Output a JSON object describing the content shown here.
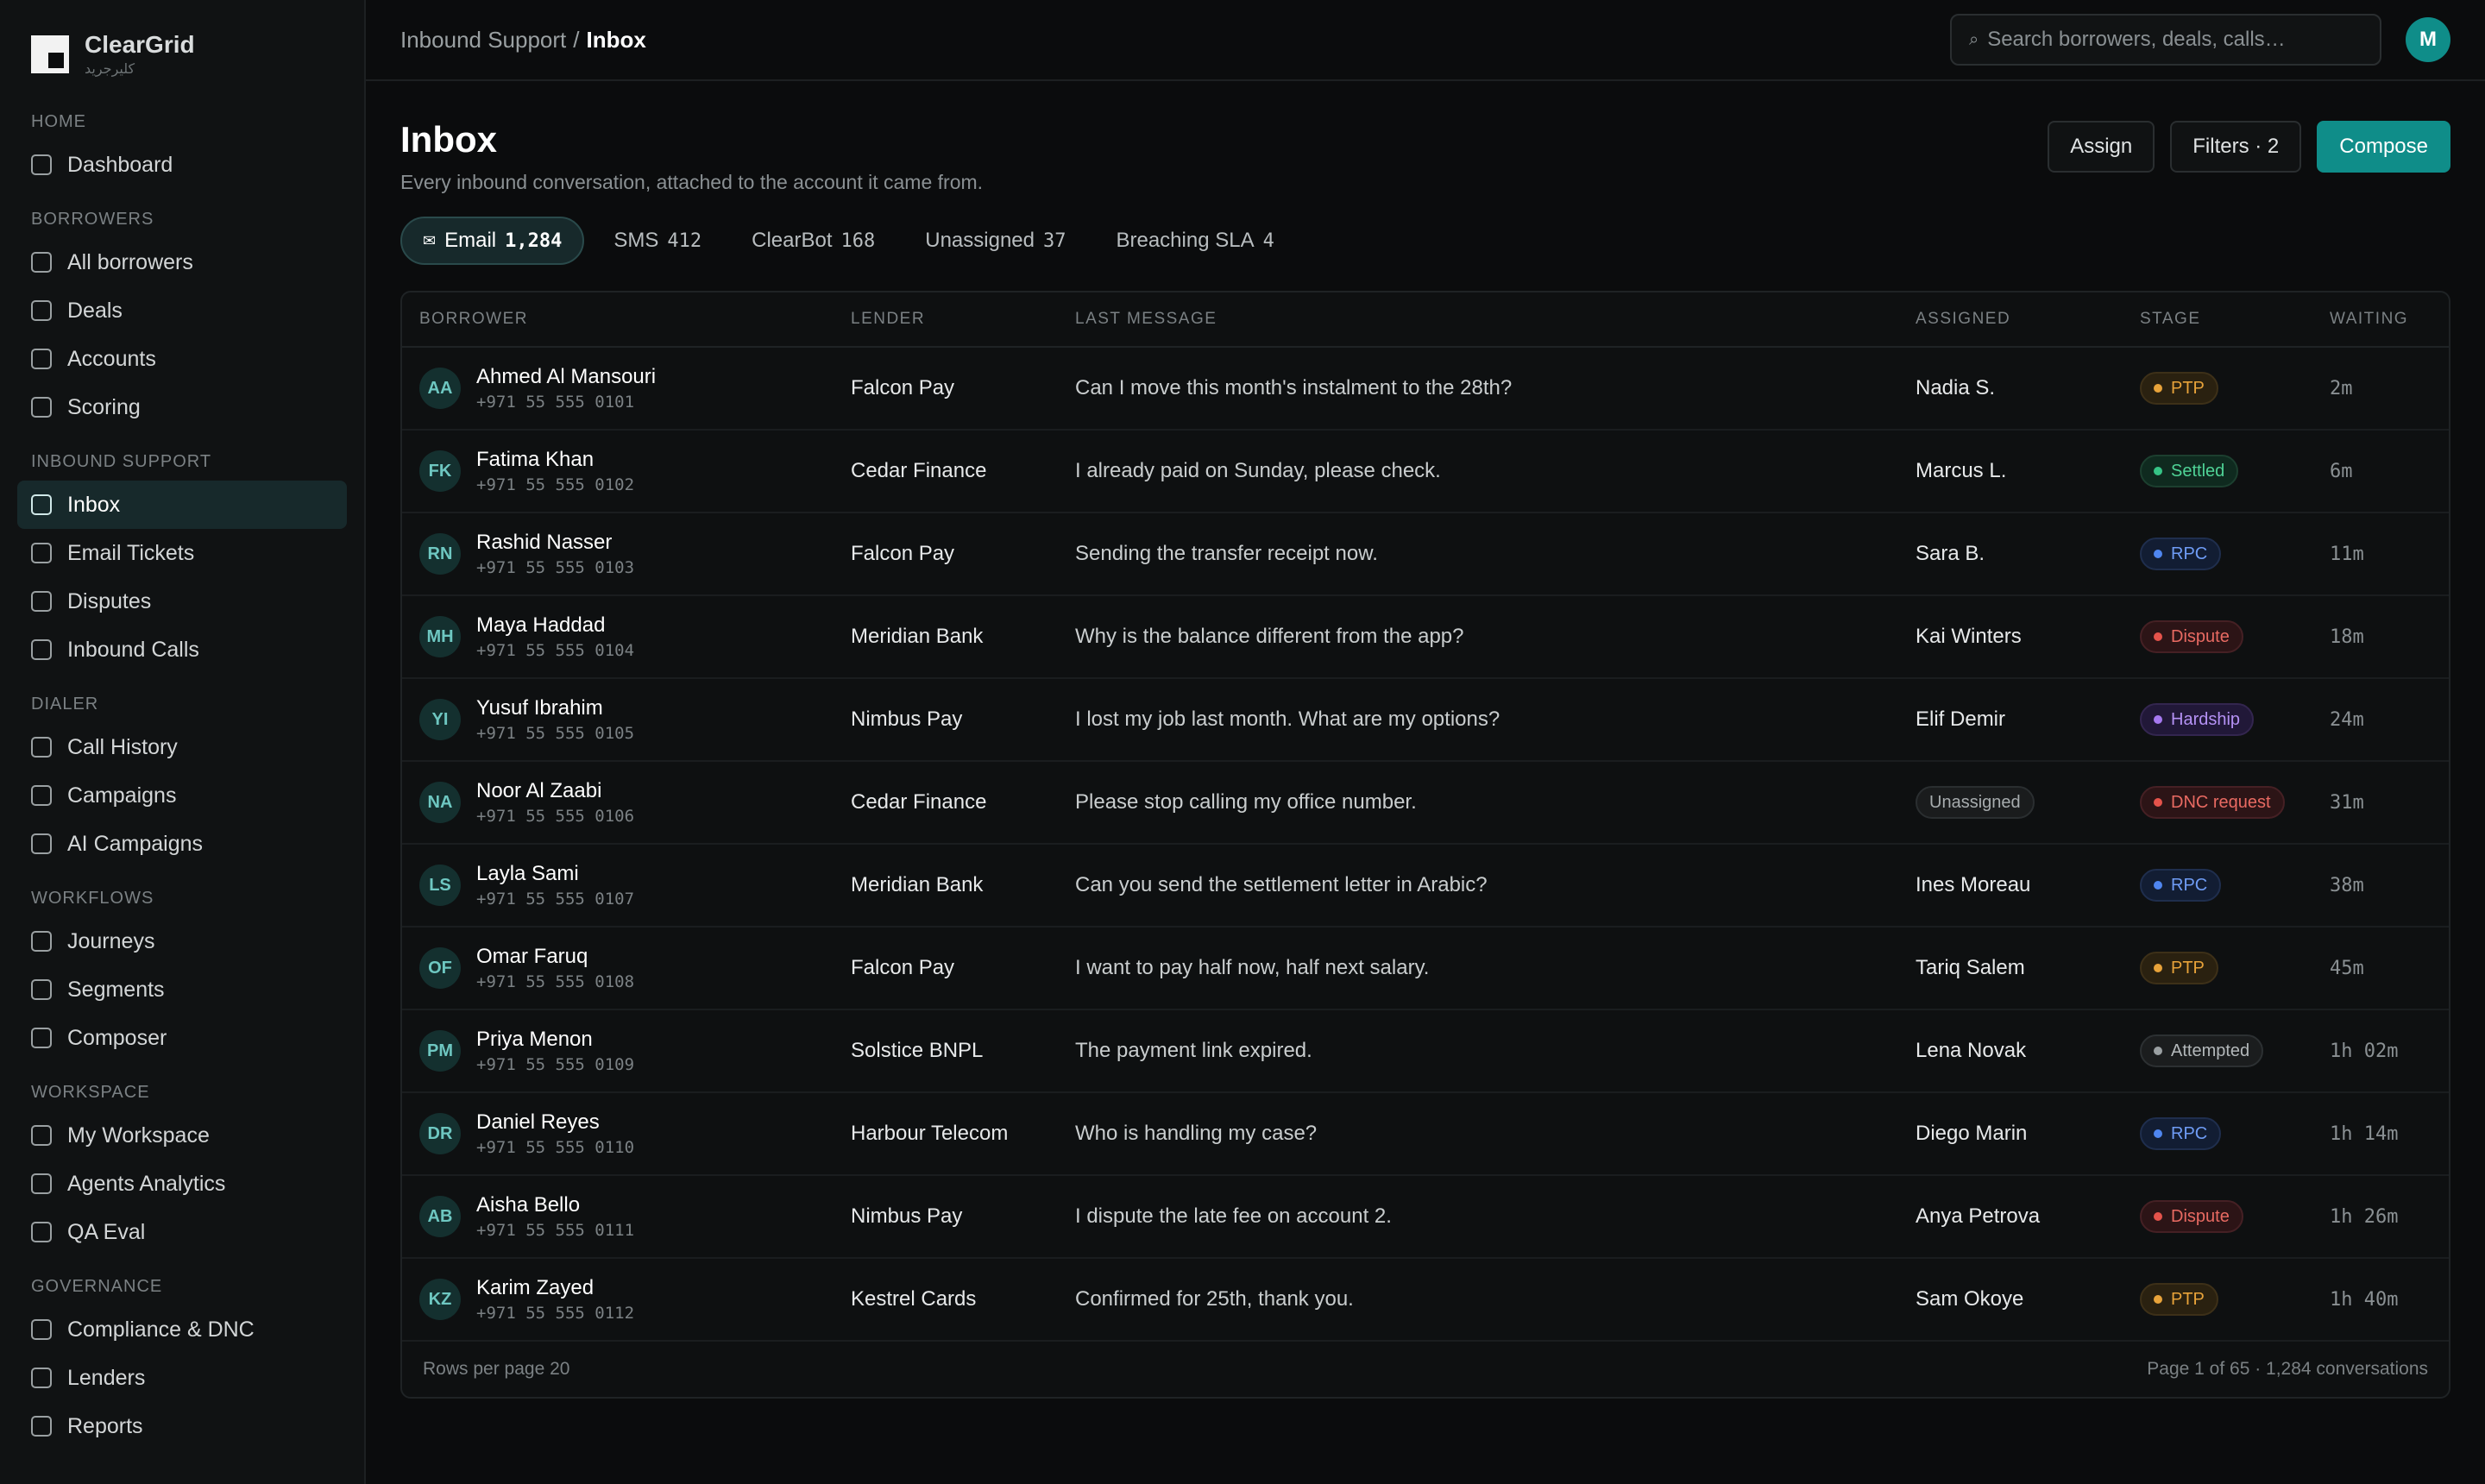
{
  "brand": {
    "name": "ClearGrid",
    "subtitle": "كليرجريد"
  },
  "sidebar": {
    "sections": [
      {
        "title": "HOME",
        "items": [
          "Dashboard"
        ]
      },
      {
        "title": "BORROWERS",
        "items": [
          "All borrowers",
          "Deals",
          "Accounts",
          "Scoring"
        ]
      },
      {
        "title": "INBOUND SUPPORT",
        "items": [
          "Inbox",
          "Email Tickets",
          "Disputes",
          "Inbound Calls"
        ]
      },
      {
        "title": "DIALER",
        "items": [
          "Call History",
          "Campaigns",
          "AI Campaigns"
        ]
      },
      {
        "title": "WORKFLOWS",
        "items": [
          "Journeys",
          "Segments",
          "Composer"
        ]
      },
      {
        "title": "WORKSPACE",
        "items": [
          "My Workspace",
          "Agents Analytics",
          "QA Eval"
        ]
      },
      {
        "title": "GOVERNANCE",
        "items": [
          "Compliance & DNC",
          "Lenders",
          "Reports"
        ]
      }
    ],
    "active_item": "Inbox"
  },
  "breadcrumb": {
    "parent": "Inbound Support",
    "separator": "/",
    "current": "Inbox"
  },
  "search": {
    "placeholder": "Search borrowers, deals, calls…",
    "icon": "search-icon"
  },
  "user": {
    "initial": "M"
  },
  "page": {
    "title": "Inbox",
    "subtitle": "Every inbound conversation, attached to the account it came from."
  },
  "actions": {
    "assign": "Assign",
    "filters": "Filters · 2",
    "compose": "Compose"
  },
  "tabs": [
    {
      "label": "Email",
      "count": "1,284",
      "icon": "✉",
      "active": true
    },
    {
      "label": "SMS",
      "count": "412",
      "active": false
    },
    {
      "label": "ClearBot",
      "count": "168",
      "active": false
    },
    {
      "label": "Unassigned",
      "count": "37",
      "active": false
    },
    {
      "label": "Breaching SLA",
      "count": "4",
      "active": false
    }
  ],
  "table": {
    "columns": [
      "BORROWER",
      "LENDER",
      "LAST MESSAGE",
      "ASSIGNED",
      "STAGE",
      "WAITING"
    ],
    "rows": [
      {
        "initials": "AA",
        "name": "Ahmed Al Mansouri",
        "phone": "+971 55 555 0101",
        "lender": "Falcon Pay",
        "message": "Can I move this month's instalment to the 28th?",
        "assigned": "Nadia S.",
        "stage": "PTP",
        "waiting": "2m"
      },
      {
        "initials": "FK",
        "name": "Fatima Khan",
        "phone": "+971 55 555 0102",
        "lender": "Cedar Finance",
        "message": "I already paid on Sunday, please check.",
        "assigned": "Marcus L.",
        "stage": "Settled",
        "waiting": "6m"
      },
      {
        "initials": "RN",
        "name": "Rashid Nasser",
        "phone": "+971 55 555 0103",
        "lender": "Falcon Pay",
        "message": "Sending the transfer receipt now.",
        "assigned": "Sara B.",
        "stage": "RPC",
        "waiting": "11m"
      },
      {
        "initials": "MH",
        "name": "Maya Haddad",
        "phone": "+971 55 555 0104",
        "lender": "Meridian Bank",
        "message": "Why is the balance different from the app?",
        "assigned": "Kai Winters",
        "stage": "Dispute",
        "waiting": "18m"
      },
      {
        "initials": "YI",
        "name": "Yusuf Ibrahim",
        "phone": "+971 55 555 0105",
        "lender": "Nimbus Pay",
        "message": "I lost my job last month. What are my options?",
        "assigned": "Elif Demir",
        "stage": "Hardship",
        "waiting": "24m"
      },
      {
        "initials": "NA",
        "name": "Noor Al Zaabi",
        "phone": "+971 55 555 0106",
        "lender": "Cedar Finance",
        "message": "Please stop calling my office number.",
        "assigned": "Unassigned",
        "assigned_unassigned": true,
        "stage": "DNC request",
        "waiting": "31m"
      },
      {
        "initials": "LS",
        "name": "Layla Sami",
        "phone": "+971 55 555 0107",
        "lender": "Meridian Bank",
        "message": "Can you send the settlement letter in Arabic?",
        "assigned": "Ines Moreau",
        "stage": "RPC",
        "waiting": "38m"
      },
      {
        "initials": "OF",
        "name": "Omar Faruq",
        "phone": "+971 55 555 0108",
        "lender": "Falcon Pay",
        "message": "I want to pay half now, half next salary.",
        "assigned": "Tariq Salem",
        "stage": "PTP",
        "waiting": "45m"
      },
      {
        "initials": "PM",
        "name": "Priya Menon",
        "phone": "+971 55 555 0109",
        "lender": "Solstice BNPL",
        "message": "The payment link expired.",
        "assigned": "Lena Novak",
        "stage": "Attempted",
        "waiting": "1h 02m"
      },
      {
        "initials": "DR",
        "name": "Daniel Reyes",
        "phone": "+971 55 555 0110",
        "lender": "Harbour Telecom",
        "message": "Who is handling my case?",
        "assigned": "Diego Marin",
        "stage": "RPC",
        "waiting": "1h 14m"
      },
      {
        "initials": "AB",
        "name": "Aisha Bello",
        "phone": "+971 55 555 0111",
        "lender": "Nimbus Pay",
        "message": "I dispute the late fee on account 2.",
        "assigned": "Anya Petrova",
        "stage": "Dispute",
        "waiting": "1h 26m"
      },
      {
        "initials": "KZ",
        "name": "Karim Zayed",
        "phone": "+971 55 555 0112",
        "lender": "Kestrel Cards",
        "message": "Confirmed for 25th, thank you.",
        "assigned": "Sam Okoye",
        "stage": "PTP",
        "waiting": "1h 40m"
      }
    ],
    "footer": {
      "rows_per_page": "Rows per page 20",
      "pagination": "Page 1 of 65 · 1,284 conversations"
    }
  },
  "stage_colors": {
    "PTP": {
      "dot": "#e8a33a",
      "text": "#e8a33a",
      "bg": "#2a2110",
      "border": "#3d3018"
    },
    "Settled": {
      "dot": "#36c486",
      "text": "#4fd396",
      "bg": "#0f2a1f",
      "border": "#1c3f2f"
    },
    "RPC": {
      "dot": "#4f86f0",
      "text": "#6f9cf5",
      "bg": "#121d33",
      "border": "#1f2e4d"
    },
    "Dispute": {
      "dot": "#e5534b",
      "text": "#e86a62",
      "bg": "#2c1416",
      "border": "#452024"
    },
    "Hardship": {
      "dot": "#a679f0",
      "text": "#b592f5",
      "bg": "#211838",
      "border": "#33264f"
    },
    "DNC request": {
      "dot": "#e5534b",
      "text": "#e86a62",
      "bg": "#2c1416",
      "border": "#452024"
    },
    "Attempted": {
      "dot": "#9aa0a2",
      "text": "#b3b8ba",
      "bg": "#1b1d1e",
      "border": "#2c3032"
    }
  }
}
